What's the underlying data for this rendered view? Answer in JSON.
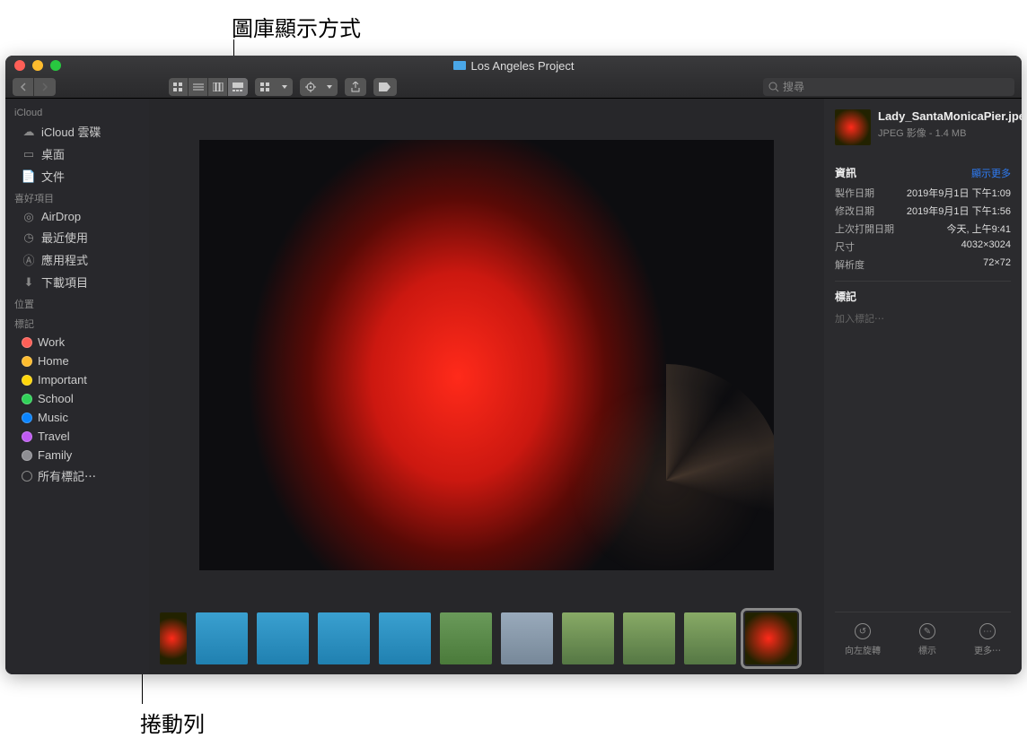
{
  "annotations": {
    "top": "圖庫顯示方式",
    "bottom": "捲動列"
  },
  "window": {
    "title": "Los Angeles Project"
  },
  "toolbar": {
    "search_placeholder": "搜尋"
  },
  "sidebar": {
    "sections": {
      "icloud": {
        "label": "iCloud",
        "items": [
          "iCloud 雲碟",
          "桌面",
          "文件"
        ]
      },
      "favorites": {
        "label": "喜好項目",
        "items": [
          "AirDrop",
          "最近使用",
          "應用程式",
          "下載項目"
        ]
      },
      "locations": {
        "label": "位置"
      },
      "tags": {
        "label": "標記",
        "items": [
          {
            "name": "Work",
            "color": "#ff5f57"
          },
          {
            "name": "Home",
            "color": "#febc2e"
          },
          {
            "name": "Important",
            "color": "#ffd60a"
          },
          {
            "name": "School",
            "color": "#30d158"
          },
          {
            "name": "Music",
            "color": "#0a84ff"
          },
          {
            "name": "Travel",
            "color": "#bf5af2"
          },
          {
            "name": "Family",
            "color": "#8e8e93"
          }
        ],
        "all_tags": "所有標記⋯"
      }
    }
  },
  "file": {
    "name": "Lady_SantaMonicaPier.jpeg",
    "kind": "JPEG 影像",
    "size": "1.4 MB"
  },
  "info": {
    "header": "資訊",
    "show_more": "顯示更多",
    "rows": [
      {
        "k": "製作日期",
        "v": "2019年9月1日 下午1:09"
      },
      {
        "k": "修改日期",
        "v": "2019年9月1日 下午1:56"
      },
      {
        "k": "上次打開日期",
        "v": "今天, 上午9:41"
      },
      {
        "k": "尺寸",
        "v": "4032×3024"
      },
      {
        "k": "解析度",
        "v": "72×72"
      }
    ]
  },
  "tags_panel": {
    "header": "標記",
    "add_placeholder": "加入標記⋯"
  },
  "actions": {
    "rotate": "向左旋轉",
    "markup": "標示",
    "more": "更多⋯"
  }
}
